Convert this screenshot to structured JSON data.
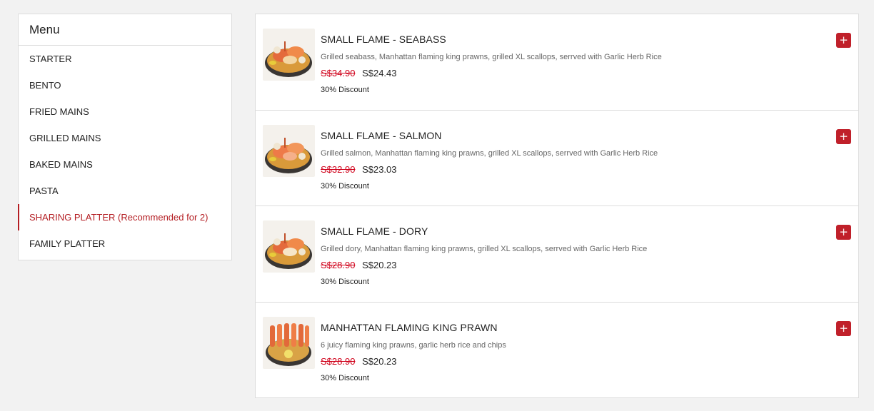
{
  "sidebar": {
    "title": "Menu",
    "items": [
      {
        "label": "STARTER"
      },
      {
        "label": "BENTO"
      },
      {
        "label": "FRIED MAINS"
      },
      {
        "label": "GRILLED MAINS"
      },
      {
        "label": "BAKED MAINS"
      },
      {
        "label": "PASTA"
      },
      {
        "label": "SHARING PLATTER (Recommended for 2)",
        "active": true
      },
      {
        "label": "FAMILY PLATTER"
      }
    ],
    "accent_color": "#b41e23"
  },
  "add_button": {
    "icon": "plus-icon",
    "glyph": "+",
    "color": "#c0202a"
  },
  "products": [
    {
      "name": "SMALL FLAME - SEABASS",
      "description": "Grilled seabass, Manhattan flaming king prawns, grilled XL scallops, serrved with Garlic Herb Rice",
      "old_price": "S$34.90",
      "new_price": "S$24.43",
      "discount": "30% Discount"
    },
    {
      "name": "SMALL FLAME - SALMON",
      "description": "Grilled salmon, Manhattan flaming king prawns, grilled XL scallops, serrved with Garlic Herb Rice",
      "old_price": "S$32.90",
      "new_price": "S$23.03",
      "discount": "30% Discount"
    },
    {
      "name": "SMALL FLAME - DORY",
      "description": "Grilled dory, Manhattan flaming king prawns, grilled XL scallops, serrved with Garlic Herb Rice",
      "old_price": "S$28.90",
      "new_price": "S$20.23",
      "discount": "30% Discount"
    },
    {
      "name": "MANHATTAN FLAMING KING PRAWN",
      "description": "6 juicy flaming king prawns, garlic herb rice and chips",
      "old_price": "S$28.90",
      "new_price": "S$20.23",
      "discount": "30% Discount"
    }
  ]
}
